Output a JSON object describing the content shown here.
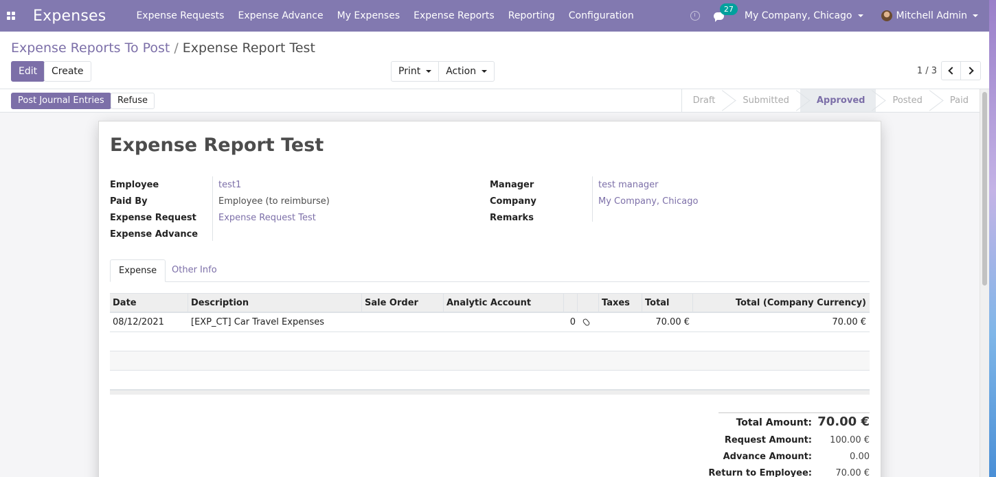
{
  "navbar": {
    "brand": "Expenses",
    "menu": [
      "Expense Requests",
      "Expense Advance",
      "My Expenses",
      "Expense Reports",
      "Reporting",
      "Configuration"
    ],
    "chat_count": "27",
    "company": "My Company, Chicago",
    "user": "Mitchell Admin"
  },
  "breadcrumb": {
    "parent": "Expense Reports To Post",
    "separator": "/",
    "current": "Expense Report Test"
  },
  "toolbar": {
    "edit": "Edit",
    "create": "Create",
    "print": "Print",
    "action": "Action"
  },
  "pager": {
    "value": "1 / 3"
  },
  "statusbar": {
    "post_button": "Post Journal Entries",
    "refuse_button": "Refuse",
    "stages": [
      "Draft",
      "Submitted",
      "Approved",
      "Posted",
      "Paid"
    ],
    "active_stage": "Approved"
  },
  "form": {
    "title": "Expense Report Test",
    "left_fields": [
      {
        "label": "Employee",
        "value": "test1",
        "link": true
      },
      {
        "label": "Paid By",
        "value": "Employee (to reimburse)",
        "link": false
      },
      {
        "label": "Expense Request",
        "value": "Expense Request Test",
        "link": true
      },
      {
        "label": "Expense Advance",
        "value": "",
        "link": false
      }
    ],
    "right_fields": [
      {
        "label": "Manager",
        "value": "test manager",
        "link": true
      },
      {
        "label": "Company",
        "value": "My Company, Chicago",
        "link": true
      },
      {
        "label": "Remarks",
        "value": "",
        "link": false
      }
    ]
  },
  "tabs": [
    "Expense",
    "Other Info"
  ],
  "table": {
    "headers": [
      "Date",
      "Description",
      "Sale Order",
      "Analytic Account",
      "",
      "",
      "Taxes",
      "Total",
      "Total (Company Currency)"
    ],
    "rows": [
      {
        "date": "08/12/2021",
        "description": "[EXP_CT] Car Travel Expenses",
        "sale_order": "",
        "analytic_account": "",
        "attachments": "0",
        "taxes": "",
        "total": "70.00 €",
        "total_company": "70.00 €"
      }
    ]
  },
  "totals": [
    {
      "label": "Total Amount:",
      "value": "70.00 €"
    },
    {
      "label": "Request Amount:",
      "value": "100.00 €"
    },
    {
      "label": "Advance Amount:",
      "value": "0.00"
    },
    {
      "label": "Return to Employee:",
      "value": "70.00 €"
    }
  ],
  "colors": {
    "navbar": "#8279b0",
    "primary": "#7c6fa8",
    "badge": "#00a09d"
  }
}
